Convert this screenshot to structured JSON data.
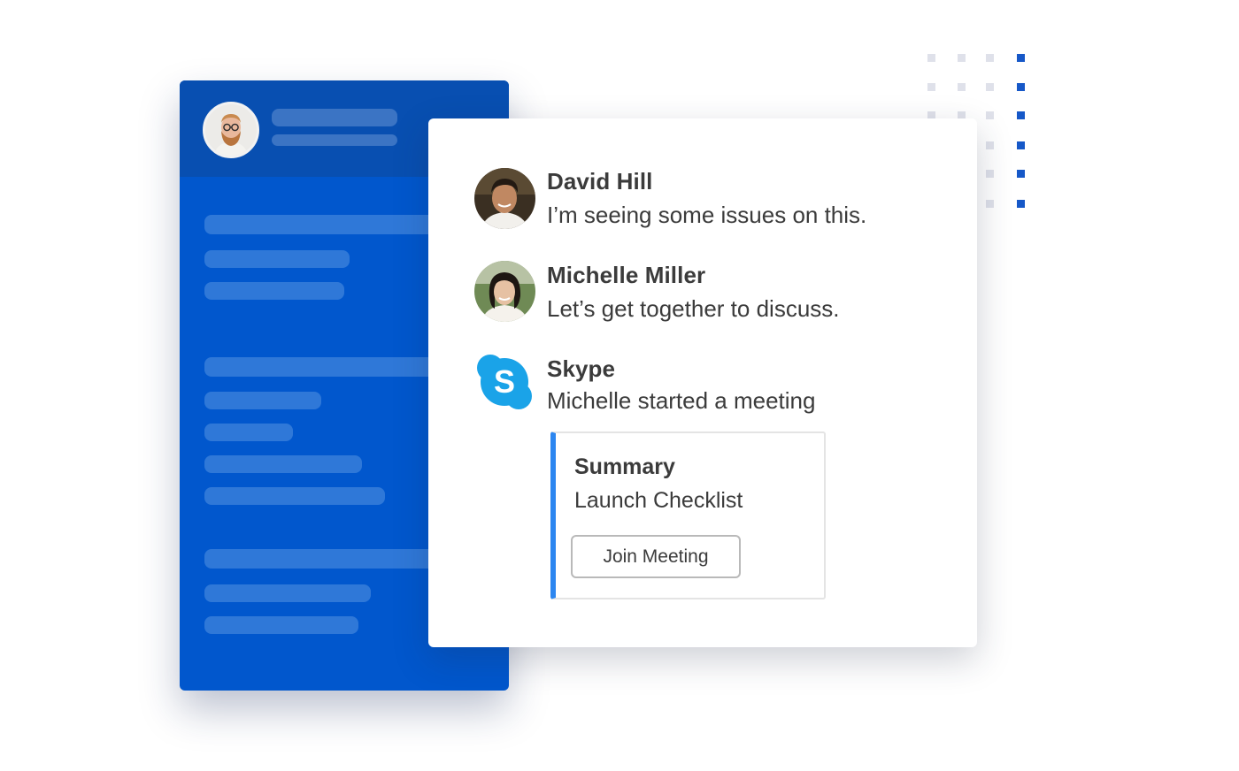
{
  "colors": {
    "panel_blue": "#0157cd",
    "panel_header_blue": "#084fb1",
    "accent_blue": "#2c86f0",
    "skype_blue": "#1aa3e8",
    "text": "#3b3b3b"
  },
  "sidebar": {
    "avatar_icon": "bearded-man-avatar",
    "placeholder_rows": 12
  },
  "messages": [
    {
      "name": "David Hill",
      "text": "I’m seeing some issues on this.",
      "avatar_icon": "david-hill-avatar"
    },
    {
      "name": "Michelle Miller",
      "text": "Let’s get together to discuss.",
      "avatar_icon": "michelle-miller-avatar"
    },
    {
      "name": "Skype",
      "text": "Michelle started a meeting",
      "avatar_icon": "skype-logo-icon"
    }
  ],
  "meeting_card": {
    "title": "Summary",
    "subtitle": "Launch Checklist",
    "button_label": "Join Meeting"
  },
  "skype_logo_letter": "S"
}
